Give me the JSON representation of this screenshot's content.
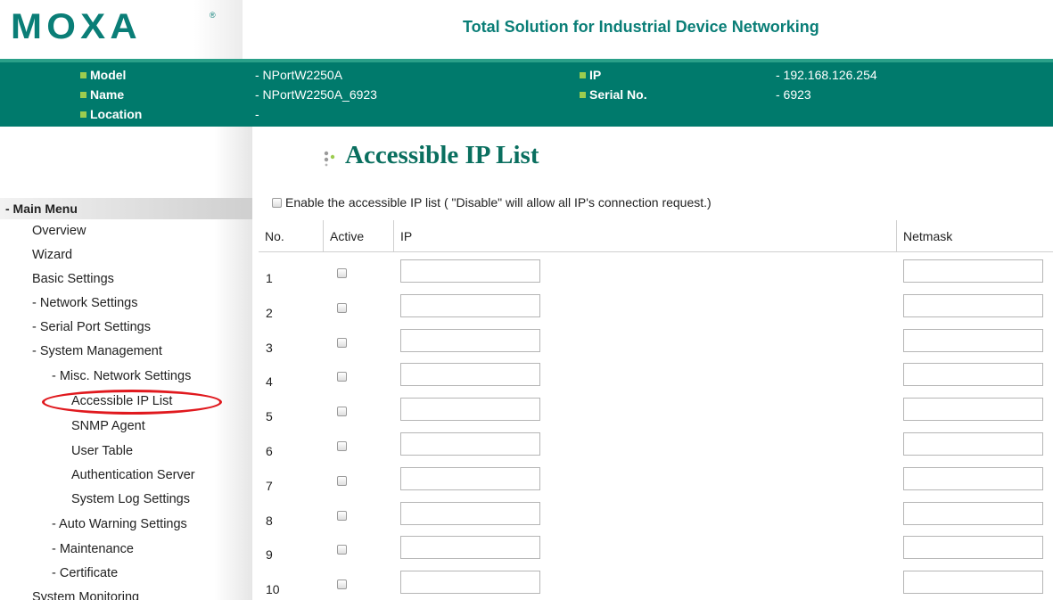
{
  "header": {
    "logo": "MOXA",
    "logo_mark": "®",
    "tagline": "Total Solution for Industrial Device Networking"
  },
  "device_info": {
    "model_label": "Model",
    "model_value": "- NPortW2250A",
    "name_label": "Name",
    "name_value": "- NPortW2250A_6923",
    "location_label": "Location",
    "location_value": "-",
    "ip_label": "IP",
    "ip_value": "- 192.168.126.254",
    "serial_label": "Serial No.",
    "serial_value": "- 6923"
  },
  "sidebar": {
    "header": "- Main Menu",
    "items": [
      {
        "label": "Overview"
      },
      {
        "label": "Wizard"
      },
      {
        "label": "Basic Settings"
      },
      {
        "label": "- Network Settings"
      },
      {
        "label": "- Serial Port Settings"
      },
      {
        "label": "- System Management"
      },
      {
        "label": "- Misc. Network Settings"
      },
      {
        "label": "Accessible IP List"
      },
      {
        "label": "SNMP Agent"
      },
      {
        "label": "User Table"
      },
      {
        "label": "Authentication Server"
      },
      {
        "label": "System Log Settings"
      },
      {
        "label": "- Auto Warning Settings"
      },
      {
        "label": "- Maintenance"
      },
      {
        "label": "- Certificate"
      },
      {
        "label": "System Monitoring"
      }
    ]
  },
  "main": {
    "title": "Accessible IP List",
    "enable_label": "Enable the accessible IP list ( \"Disable\" will allow all IP's connection request.)",
    "enable_checked": false,
    "columns": {
      "no": "No.",
      "active": "Active",
      "ip": "IP",
      "netmask": "Netmask"
    },
    "rows": [
      {
        "no": "1",
        "active": false,
        "ip": "",
        "netmask": ""
      },
      {
        "no": "2",
        "active": false,
        "ip": "",
        "netmask": ""
      },
      {
        "no": "3",
        "active": false,
        "ip": "",
        "netmask": ""
      },
      {
        "no": "4",
        "active": false,
        "ip": "",
        "netmask": ""
      },
      {
        "no": "5",
        "active": false,
        "ip": "",
        "netmask": ""
      },
      {
        "no": "6",
        "active": false,
        "ip": "",
        "netmask": ""
      },
      {
        "no": "7",
        "active": false,
        "ip": "",
        "netmask": ""
      },
      {
        "no": "8",
        "active": false,
        "ip": "",
        "netmask": ""
      },
      {
        "no": "9",
        "active": false,
        "ip": "",
        "netmask": ""
      },
      {
        "no": "10",
        "active": false,
        "ip": "",
        "netmask": ""
      }
    ]
  },
  "colors": {
    "brand_teal": "#0a7e77",
    "info_bar": "#007a6c",
    "bullet_green": "#9ccc4f",
    "highlight_red": "#e0191e"
  }
}
